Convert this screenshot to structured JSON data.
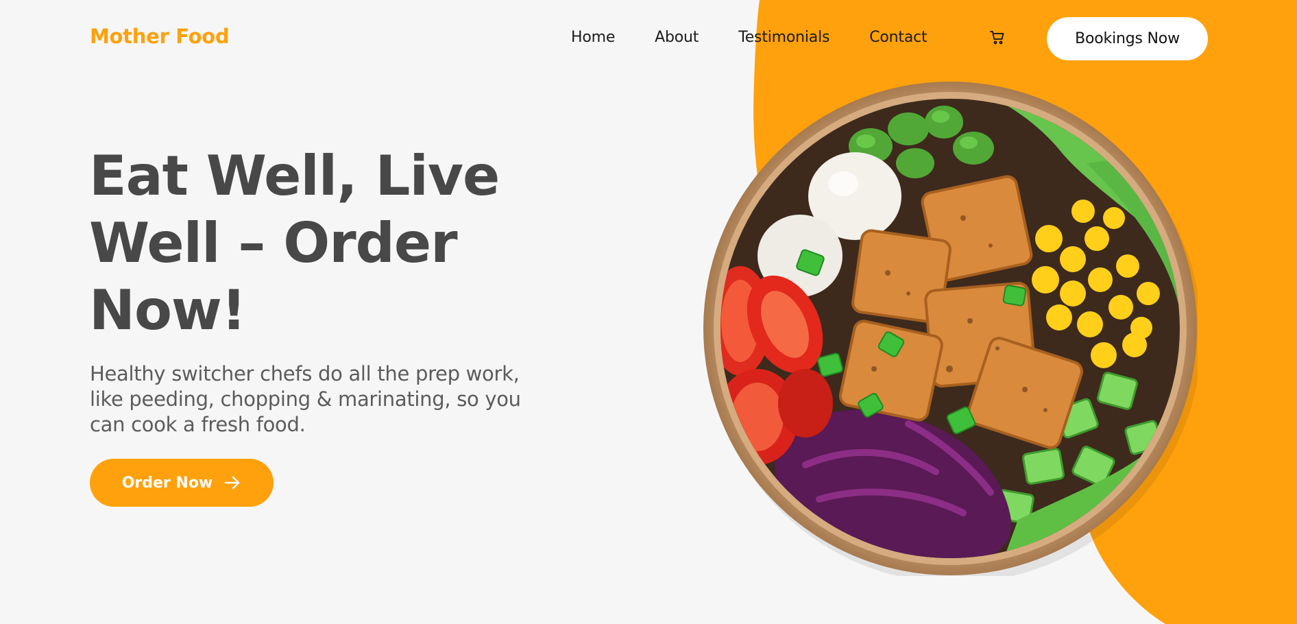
{
  "brand": {
    "name": "Mother Food",
    "accent_color": "#ffa10c"
  },
  "nav": {
    "items": [
      {
        "label": "Home"
      },
      {
        "label": "About"
      },
      {
        "label": "Testimonials"
      },
      {
        "label": "Contact"
      }
    ],
    "cart_icon": "cart-icon",
    "bookings_label": "Bookings Now"
  },
  "hero": {
    "title": "Eat Well, Live Well – Order Now!",
    "subtitle": "Healthy switcher chefs do all the prep work, like peeding, chopping & marinating, so you can cook a fresh food.",
    "cta_label": "Order Now",
    "cta_icon": "arrow-right-icon"
  },
  "image": {
    "subject": "food-bowl-image"
  }
}
